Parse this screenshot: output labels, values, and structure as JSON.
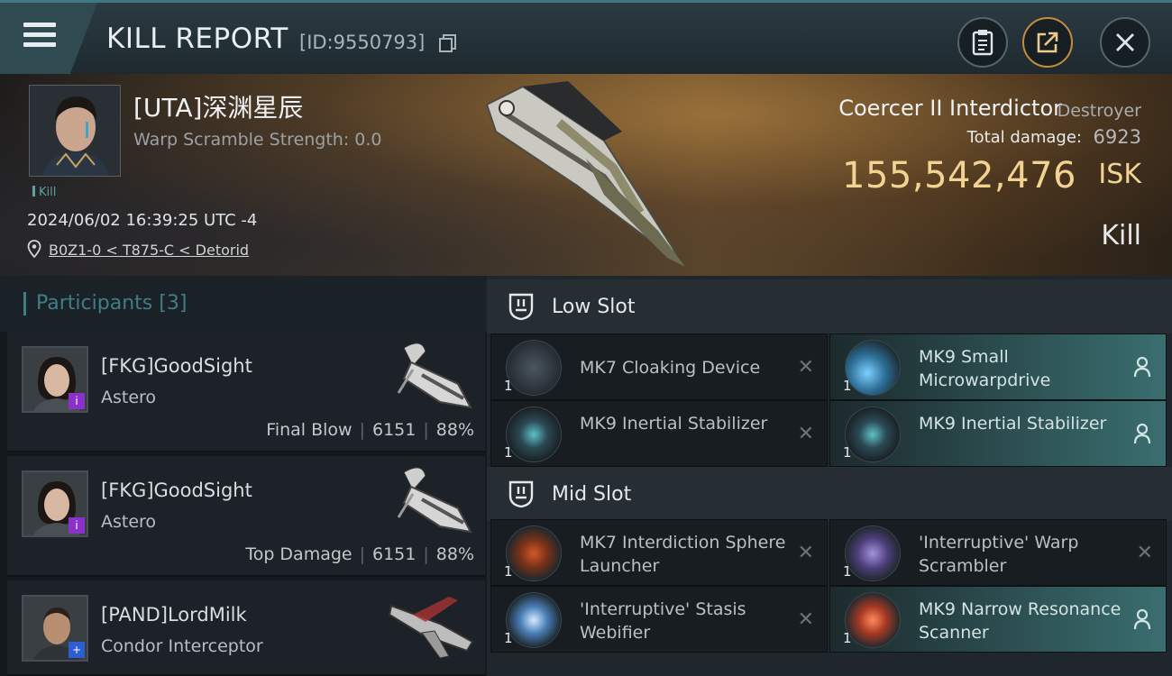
{
  "header": {
    "title": "KILL REPORT",
    "report_id": "[ID:9550793]",
    "icons": [
      "menu-icon",
      "copy-icon",
      "clipboard-icon",
      "share-icon",
      "close-icon"
    ]
  },
  "victim": {
    "name": "[UTA]深渊星辰",
    "warp_scramble": "Warp Scramble Strength: 0.0",
    "tag": "Kill",
    "timestamp": "2024/06/02 16:39:25 UTC -4",
    "location": "B0Z1-0 < T875-C < Detorid",
    "ship_name": "Coercer II Interdictor",
    "ship_class": "Destroyer",
    "total_damage_label": "Total damage:",
    "total_damage": "6923",
    "isk_value": "155,542,476",
    "isk_unit": "ISK",
    "result": "Kill"
  },
  "participants": {
    "title": "Participants",
    "count": "[3]",
    "rows": [
      {
        "name": "[FKG]GoodSight",
        "ship": "Astero",
        "role": "Final Blow",
        "damage": "6151",
        "percent": "88%",
        "badge": "i"
      },
      {
        "name": "[FKG]GoodSight",
        "ship": "Astero",
        "role": "Top Damage",
        "damage": "6151",
        "percent": "88%",
        "badge": "i"
      },
      {
        "name": "[PAND]LordMilk",
        "ship": "Condor Interceptor",
        "badge": "+"
      }
    ]
  },
  "low_slot": {
    "title": "Low Slot",
    "modules": [
      {
        "name": "MK7 Cloaking Device",
        "qty": "1",
        "fitted": false
      },
      {
        "name": "MK9 Small Microwarpdrive",
        "qty": "1",
        "fitted": true
      },
      {
        "name": "MK9 Inertial Stabilizer",
        "qty": "1",
        "fitted": false
      },
      {
        "name": "MK9 Inertial Stabilizer",
        "qty": "1",
        "fitted": true
      }
    ]
  },
  "mid_slot": {
    "title": "Mid Slot",
    "modules": [
      {
        "name": "MK7 Interdiction Sphere Launcher",
        "qty": "1",
        "fitted": false
      },
      {
        "name": "'Interruptive' Warp Scrambler",
        "qty": "1",
        "fitted": false
      },
      {
        "name": "'Interruptive' Stasis Webifier",
        "qty": "1",
        "fitted": false
      },
      {
        "name": "MK9 Narrow Resonance Scanner",
        "qty": "1",
        "fitted": true
      }
    ]
  },
  "colors": {
    "accent_teal": "#3f7e86",
    "isk_gold": "#f2d391",
    "fitted_teal": "#3a6e70",
    "badge_purple": "#8a32c8",
    "badge_blue": "#2d5fd0"
  }
}
